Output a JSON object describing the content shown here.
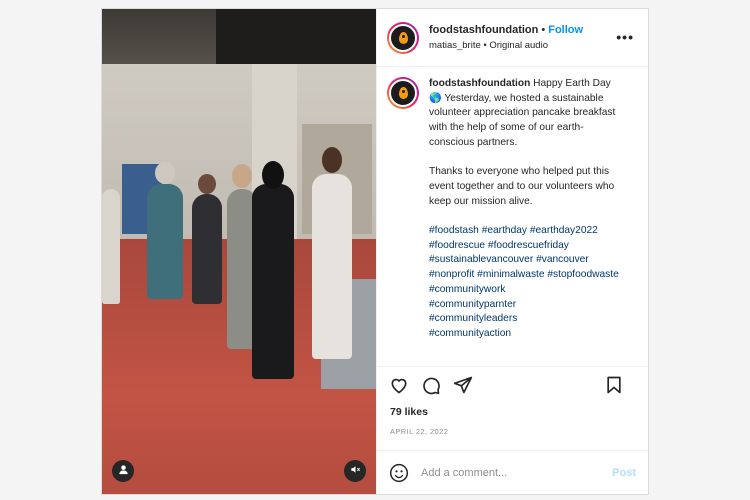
{
  "header": {
    "username": "foodstashfoundation",
    "separator": "•",
    "follow_label": "Follow",
    "audio_user": "matias_brite",
    "audio_sep": "•",
    "audio_label": "Original audio",
    "more_label": "•••"
  },
  "caption": {
    "username": "foodstashfoundation",
    "text1": "Happy Earth Day",
    "globe": "🌎",
    "text2": "Yesterday, we hosted a sustainable volunteer appreciation pancake breakfast with the help of some of our earth-conscious partners.",
    "para2": "Thanks to everyone who helped put this event together and to our volunteers who keep our mission alive.",
    "hashtags": [
      "#foodstash",
      "#earthday",
      "#earthday2022",
      "#foodrescue",
      "#foodrescuefriday",
      "#sustainablevancouver",
      "#vancouver",
      "#nonprofit",
      "#minimalwaste",
      "#stopfoodwaste",
      "#communitywork",
      "#communityparnter",
      "#communityleaders",
      "#communityaction"
    ]
  },
  "stats": {
    "likes": "79 likes",
    "date": "APRIL 22, 2022"
  },
  "comment": {
    "placeholder": "Add a comment...",
    "post_label": "Post"
  },
  "icons": {
    "like": "heart-icon",
    "comment": "comment-icon",
    "share": "paper-plane-icon",
    "save": "bookmark-icon",
    "emoji": "smiley-icon",
    "user_tag": "user-icon",
    "mute": "speaker-muted-icon"
  },
  "colors": {
    "follow": "#0095f6",
    "hashtag": "#00376b",
    "post_disabled": "#b2dffc",
    "muted_text": "#8e8e8e"
  }
}
